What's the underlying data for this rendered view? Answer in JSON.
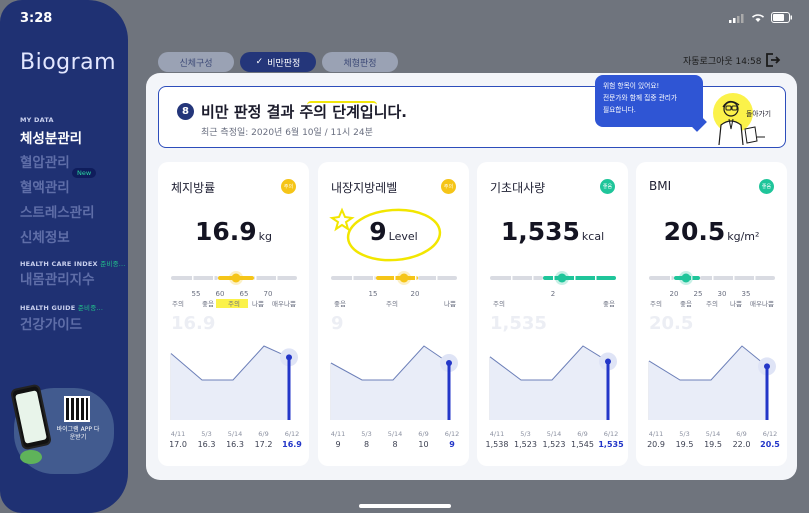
{
  "status_bar": {
    "time": "3:28"
  },
  "sidebar": {
    "logo": "Biogram",
    "sections": [
      {
        "label": "MY DATA",
        "badge": ""
      },
      {
        "label": "HEALTH CARE INDEX",
        "badge": "준비중..."
      },
      {
        "label": "HEALTH GUIDE",
        "badge": "준비중..."
      }
    ],
    "items": [
      {
        "label": "체성분관리",
        "active": true
      },
      {
        "label": "혈압관리",
        "active": false
      },
      {
        "label": "혈액관리",
        "active": false
      },
      {
        "label": "스트레스관리",
        "active": false
      },
      {
        "label": "신체정보",
        "active": false
      },
      {
        "label": "내몸관리지수",
        "active": false
      },
      {
        "label": "건강가이드",
        "active": false
      }
    ],
    "new_badge": "New",
    "promo_text": "바이그램 APP 다운받기"
  },
  "tabs": [
    {
      "label": "신체구성",
      "active": false
    },
    {
      "label": "비만판정",
      "active": true
    },
    {
      "label": "체형판정",
      "active": false
    }
  ],
  "auto_logout": "자동로그아웃 14:58",
  "banner": {
    "badge": "8",
    "title": "비만 판정 결과 주의 단계입니다.",
    "subtitle": "최근 측정일: 2020년 6월 10일 / 11시 24분",
    "bubble_line1": "위험 항목이 있어요!",
    "bubble_line2": "전문가와 함께 집중 관리가",
    "bubble_line3": "필요합니다.",
    "go_back": "돌아가기"
  },
  "colors": {
    "warning": "#f5c518",
    "good": "#1fc59a",
    "accent": "#2336c8",
    "navy": "#1f3173",
    "highlight": "#fbf24a"
  },
  "cards": [
    {
      "title": "체지방률",
      "status": "주의",
      "status_color": "#f5c518",
      "value": "16.9",
      "unit": "kg",
      "scale_ticks": [
        "55",
        "60",
        "65",
        "70"
      ],
      "scale_labels": [
        "주의",
        "좋음",
        "주의",
        "나쁨",
        "매우나쁨"
      ],
      "history_dates": [
        "4/11",
        "5/3",
        "5/14",
        "6/9",
        "6/12"
      ],
      "history_values": [
        "17.0",
        "16.3",
        "16.3",
        "17.2",
        "16.9"
      ]
    },
    {
      "title": "내장지방레벨",
      "status": "주의",
      "status_color": "#f5c518",
      "value": "9",
      "unit": "Level",
      "scale_ticks": [
        "15",
        "20"
      ],
      "scale_labels": [
        "좋음",
        "주의",
        "나쁨"
      ],
      "history_dates": [
        "4/11",
        "5/3",
        "5/14",
        "6/9",
        "6/12"
      ],
      "history_values": [
        "9",
        "8",
        "8",
        "10",
        "9"
      ]
    },
    {
      "title": "기초대사량",
      "status": "좋음",
      "status_color": "#1fc59a",
      "value": "1,535",
      "unit": "kcal",
      "scale_ticks": [
        "2"
      ],
      "scale_labels": [
        "주의",
        "좋음"
      ],
      "history_dates": [
        "4/11",
        "5/3",
        "5/14",
        "6/9",
        "6/12"
      ],
      "history_values": [
        "1,538",
        "1,523",
        "1,523",
        "1,545",
        "1,535"
      ]
    },
    {
      "title": "BMI",
      "status": "좋음",
      "status_color": "#1fc59a",
      "value": "20.5",
      "unit": "kg/m²",
      "scale_ticks": [
        "20",
        "25",
        "30",
        "35"
      ],
      "scale_labels": [
        "주의",
        "좋음",
        "주의",
        "나쁨",
        "매우나쁨"
      ],
      "history_dates": [
        "4/11",
        "5/3",
        "5/14",
        "6/9",
        "6/12"
      ],
      "history_values": [
        "20.9",
        "19.5",
        "19.5",
        "22.0",
        "20.5"
      ]
    }
  ],
  "chart_data": [
    {
      "type": "area",
      "title": "체지방률",
      "x": [
        "4/11",
        "5/3",
        "5/14",
        "6/9",
        "6/12"
      ],
      "values": [
        17.0,
        16.3,
        16.3,
        17.2,
        16.9
      ],
      "grid": true
    },
    {
      "type": "area",
      "title": "내장지방레벨",
      "x": [
        "4/11",
        "5/3",
        "5/14",
        "6/9",
        "6/12"
      ],
      "values": [
        9,
        8,
        8,
        10,
        9
      ],
      "grid": true
    },
    {
      "type": "area",
      "title": "기초대사량",
      "x": [
        "4/11",
        "5/3",
        "5/14",
        "6/9",
        "6/12"
      ],
      "values": [
        1538,
        1523,
        1523,
        1545,
        1535
      ],
      "grid": true
    },
    {
      "type": "area",
      "title": "BMI",
      "x": [
        "4/11",
        "5/3",
        "5/14",
        "6/9",
        "6/12"
      ],
      "values": [
        20.9,
        19.5,
        19.5,
        22.0,
        20.5
      ],
      "grid": true
    }
  ]
}
